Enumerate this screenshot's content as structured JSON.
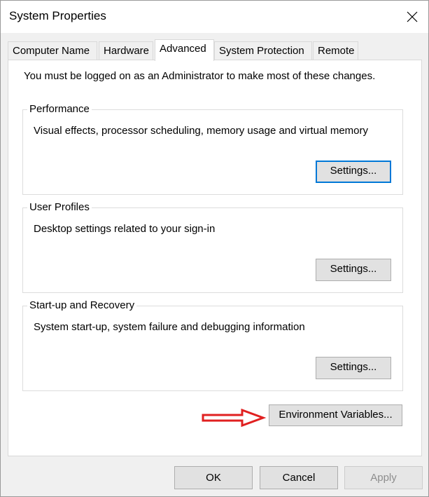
{
  "window": {
    "title": "System Properties",
    "close_icon": "close-icon"
  },
  "tabs": [
    {
      "label": "Computer Name",
      "active": false
    },
    {
      "label": "Hardware",
      "active": false
    },
    {
      "label": "Advanced",
      "active": true
    },
    {
      "label": "System Protection",
      "active": false
    },
    {
      "label": "Remote",
      "active": false
    }
  ],
  "advanced": {
    "admin_note": "You must be logged on as an Administrator to make most of these changes.",
    "performance": {
      "label": "Performance",
      "description": "Visual effects, processor scheduling, memory usage and virtual memory",
      "button": "Settings..."
    },
    "user_profiles": {
      "label": "User Profiles",
      "description": "Desktop settings related to your sign-in",
      "button": "Settings..."
    },
    "startup_recovery": {
      "label": "Start-up and Recovery",
      "description": "System start-up, system failure and debugging information",
      "button": "Settings..."
    },
    "environment_button": "Environment Variables...",
    "annotation_arrow_color": "#e02020"
  },
  "footer": {
    "ok": "OK",
    "cancel": "Cancel",
    "apply": "Apply",
    "apply_disabled": true
  }
}
